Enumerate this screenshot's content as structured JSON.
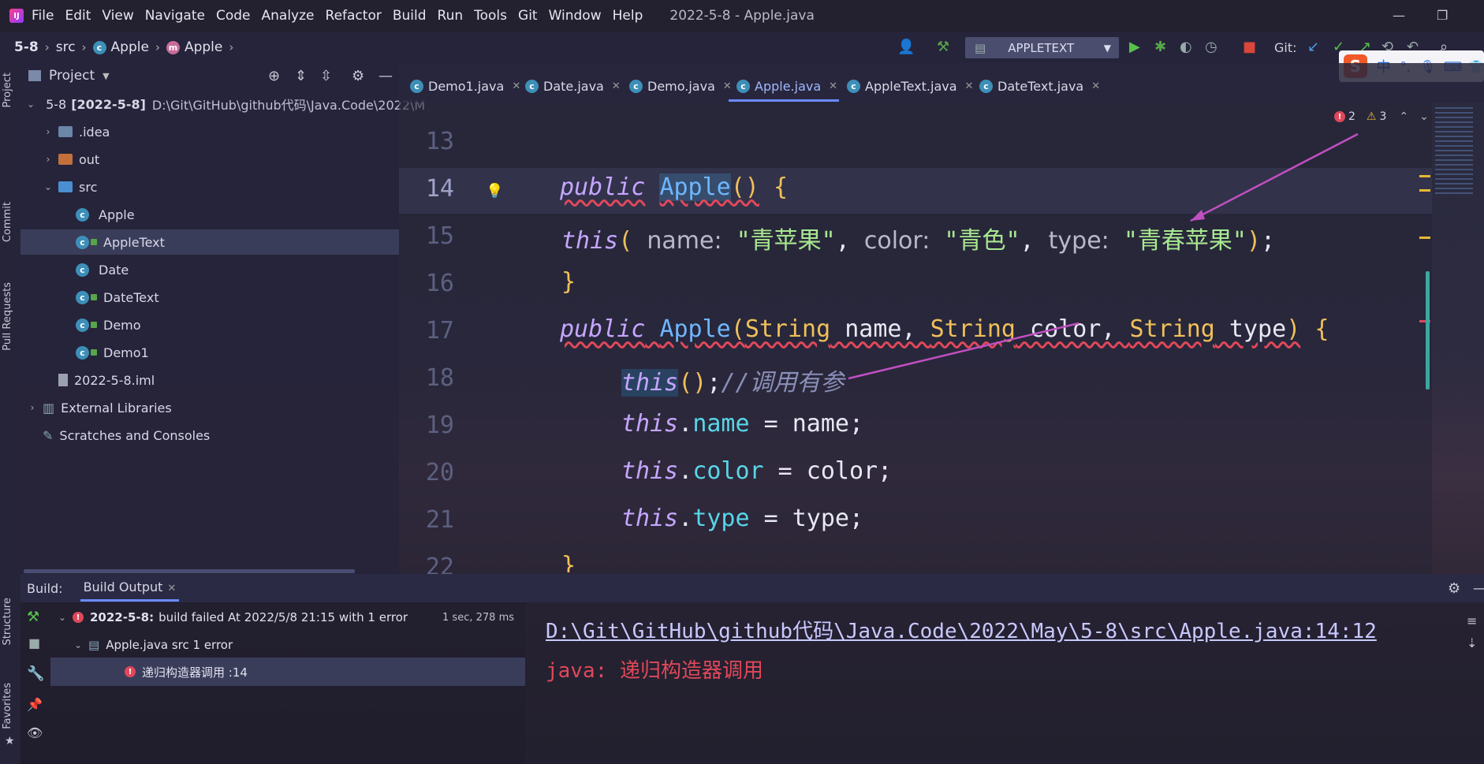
{
  "menubar": {
    "items": [
      "File",
      "Edit",
      "View",
      "Navigate",
      "Code",
      "Analyze",
      "Refactor",
      "Build",
      "Run",
      "Tools",
      "Git",
      "Window",
      "Help"
    ],
    "window_title": "2022-5-8 - Apple.java"
  },
  "breadcrumb": {
    "project": "5-8",
    "folder": "src",
    "class": "Apple",
    "method": "Apple"
  },
  "toolbar": {
    "run_config": "APPLETEXT",
    "git_label": "Git:"
  },
  "left_stripe": {
    "project": "Project",
    "commit": "Commit",
    "pull_requests": "Pull Requests",
    "structure": "Structure",
    "favorites": "Favorites"
  },
  "project_panel": {
    "title": "Project",
    "root_name": "5-8",
    "root_bold": "[2022-5-8]",
    "root_path": "D:\\Git\\GitHub\\github代码\\Java.Code\\2022\\M",
    "items": [
      ".idea",
      "out",
      "src",
      "Apple",
      "AppleText",
      "Date",
      "DateText",
      "Demo",
      "Demo1",
      "2022-5-8.iml",
      "External Libraries",
      "Scratches and Consoles"
    ]
  },
  "tabs": [
    "Demo1.java",
    "Date.java",
    "Demo.java",
    "Apple.java",
    "AppleText.java",
    "DateText.java"
  ],
  "inspections": {
    "errors": "2",
    "warnings": "3"
  },
  "editor": {
    "line_numbers": [
      "13",
      "14",
      "15",
      "16",
      "17",
      "18",
      "19",
      "20",
      "21",
      "22"
    ],
    "hint_name": "name:",
    "hint_color": "color:",
    "hint_type": "type:",
    "str_name": "\"青苹果\"",
    "str_color": "\"青色\"",
    "str_type": "\"青春苹果\"",
    "comment": "//调用有参"
  },
  "build": {
    "label": "Build:",
    "tab": "Build Output",
    "summary_bold": "2022-5-8:",
    "summary": "build failed At 2022/5/8 21:15 with 1 error",
    "duration": "1 sec, 278 ms",
    "file_item": "Apple.java src 1 error",
    "error_item": "递归构造器调用 :14",
    "output_path": "D:\\Git\\GitHub\\github代码\\Java.Code\\2022\\May\\5-8\\src\\Apple.java:14:12",
    "output_prefix": "java:",
    "output_message": "递归构造器调用"
  },
  "ime": {
    "mode": "中"
  },
  "colors": {
    "accent": "#6a8cff",
    "error": "#e0485a",
    "keyword": "#c5a6ff",
    "string": "#a8e890",
    "field": "#58d6e8"
  }
}
